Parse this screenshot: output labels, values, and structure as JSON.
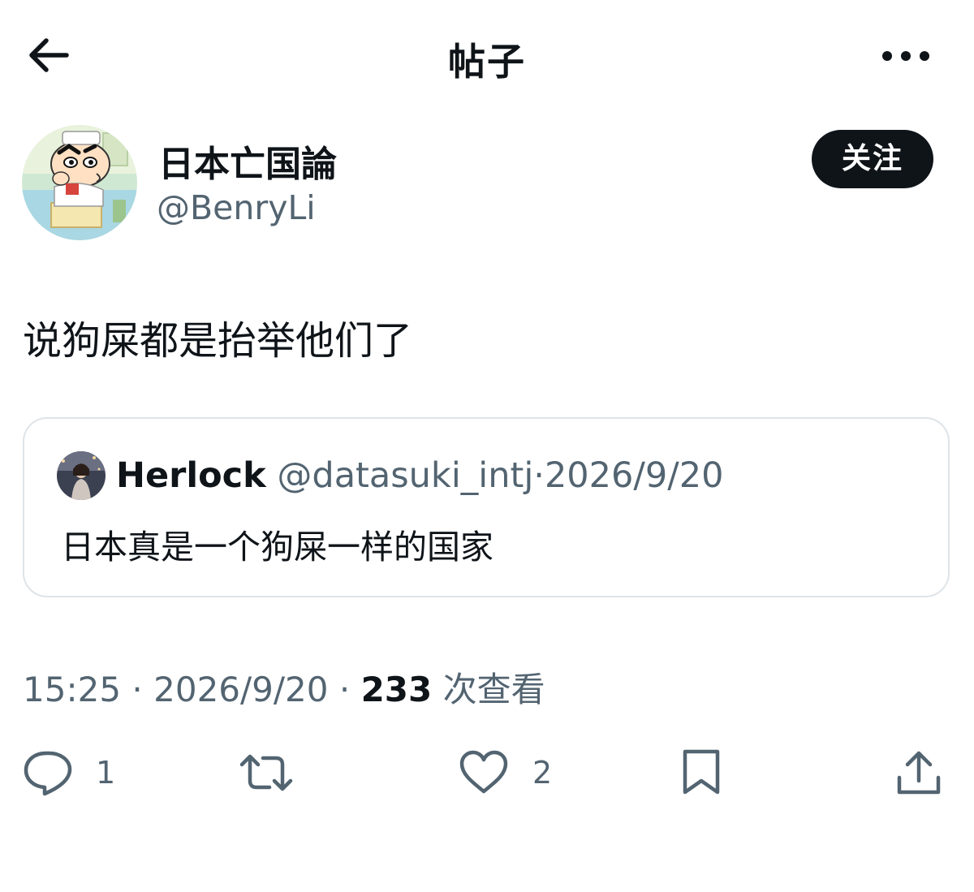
{
  "header": {
    "title": "帖子",
    "back_icon": "arrow-left-icon",
    "more_icon": "more-horizontal-icon"
  },
  "author": {
    "display_name": "日本亡国論",
    "handle": "@BenryLi",
    "avatar": "cartoon-avatar",
    "follow_label": "关注"
  },
  "post": {
    "text": "说狗屎都是抬举他们了"
  },
  "quote": {
    "name": "Herlock",
    "handle": "@datasuki_intj",
    "separator": "·",
    "date": "2026/9/20",
    "text": "日本真是一个狗屎一样的国家"
  },
  "meta": {
    "time": "15:25",
    "separator": "·",
    "date": "2026/9/20",
    "views_count": "233",
    "views_label": "次查看"
  },
  "actions": {
    "reply_count": "1",
    "like_count": "2",
    "reply_icon": "reply-icon",
    "retweet_icon": "retweet-icon",
    "like_icon": "heart-icon",
    "bookmark_icon": "bookmark-icon",
    "share_icon": "share-icon"
  },
  "colors": {
    "text_primary": "#0f1419",
    "text_secondary": "#536471",
    "border": "#dfe4e8",
    "follow_bg": "#0f1419"
  }
}
